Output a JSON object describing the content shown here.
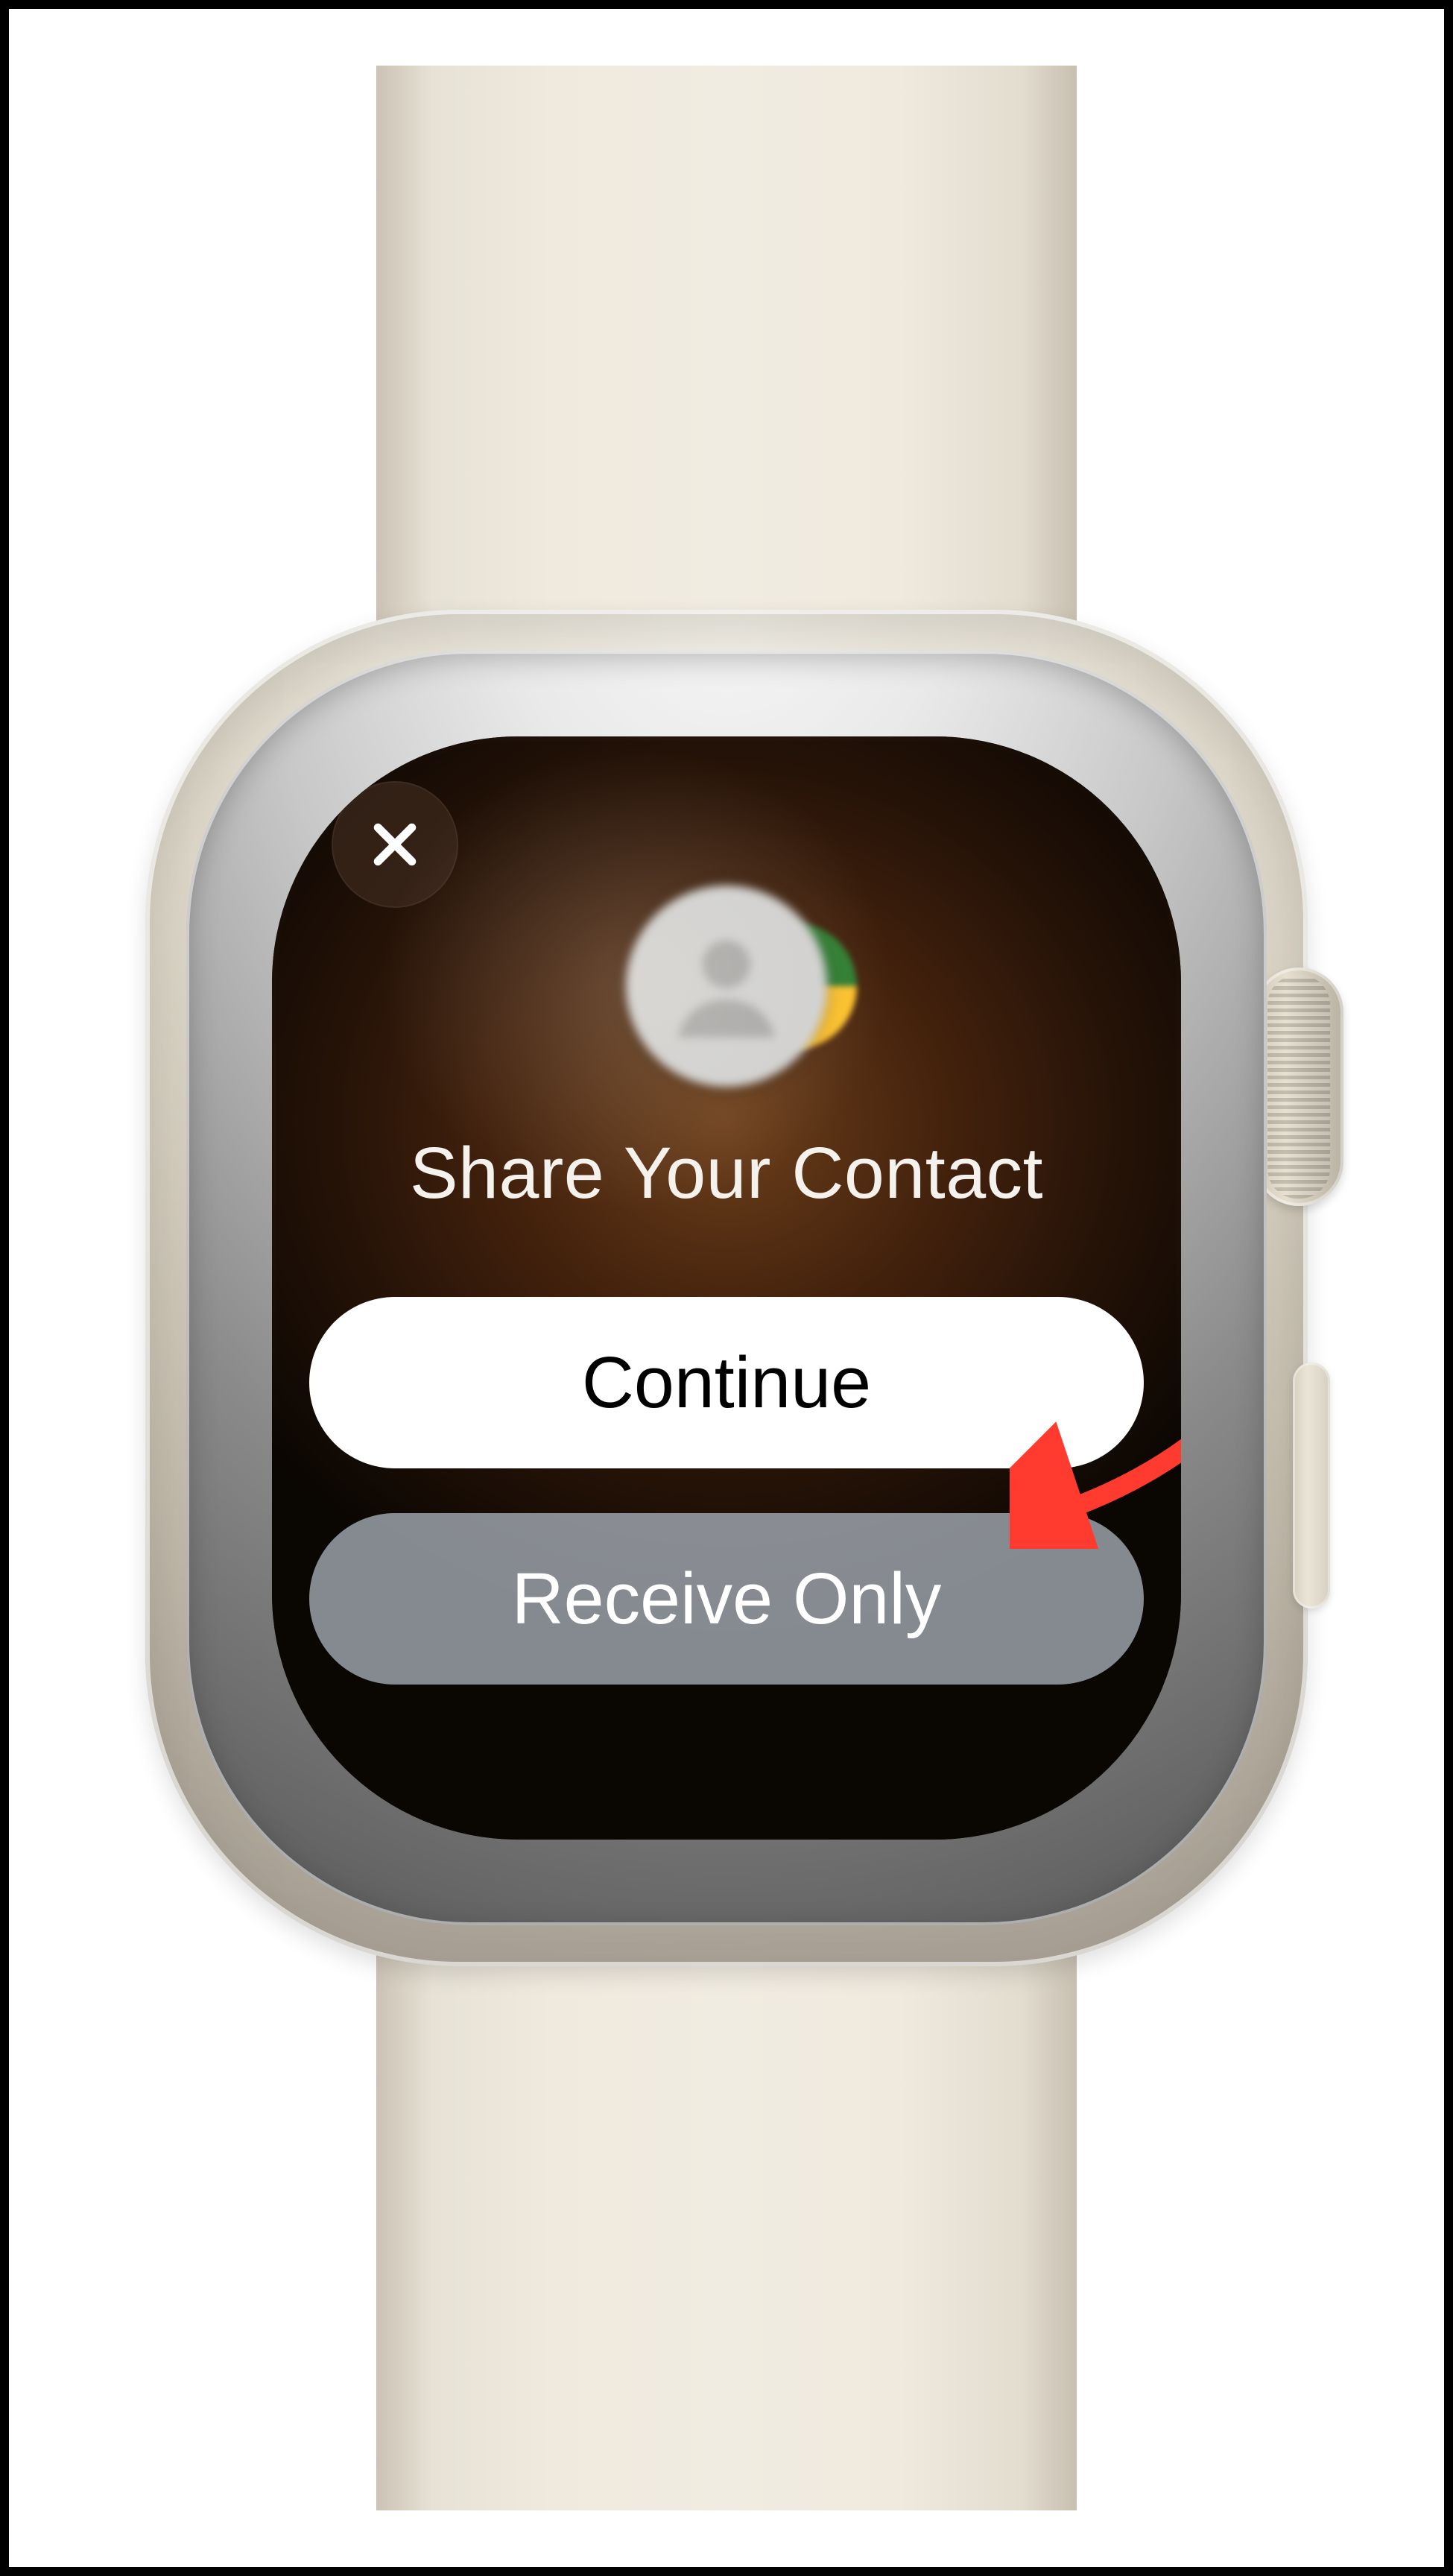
{
  "dialog": {
    "title": "Share Your Contact",
    "close_glyph": "✕",
    "primary_button": "Continue",
    "secondary_button": "Receive Only"
  },
  "annotation": {
    "points_to": "continue-button",
    "color": "#ff3b30"
  }
}
